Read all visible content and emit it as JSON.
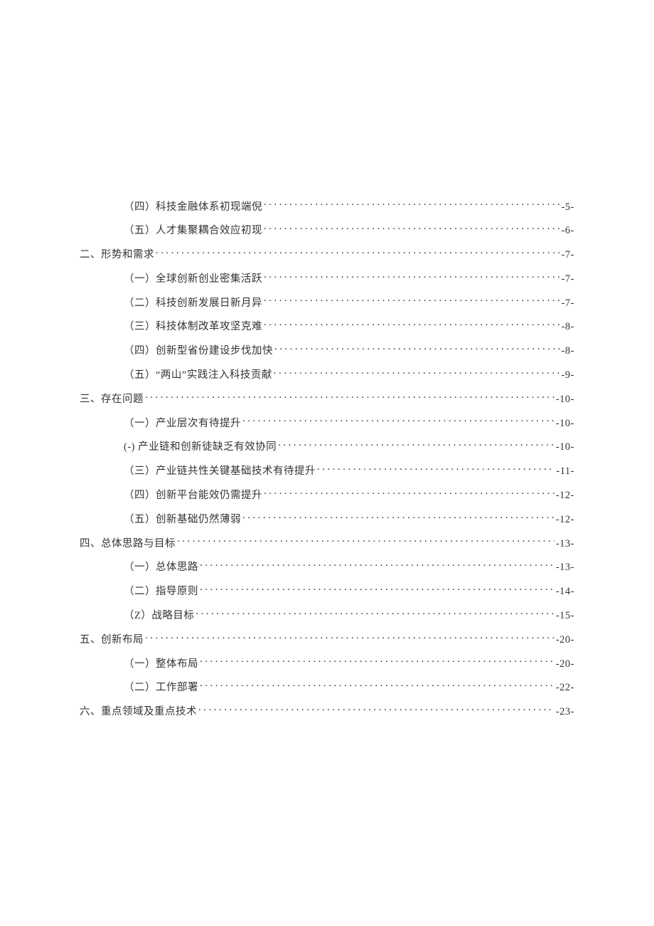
{
  "toc": [
    {
      "level": 2,
      "label": "（四）科技金融体系初现端倪",
      "page": "-5-"
    },
    {
      "level": 2,
      "label": "（五）人才集聚耦合效应初现",
      "page": "-6-"
    },
    {
      "level": 1,
      "label": "二、形势和需求",
      "page": "-7-"
    },
    {
      "level": 2,
      "label": "（一）全球创新创业密集活跃",
      "page": "-7-"
    },
    {
      "level": 2,
      "label": "（二）科技创新发展日新月异",
      "page": "-7-"
    },
    {
      "level": 2,
      "label": "（三）科技体制改革攻坚克难",
      "page": "-8-"
    },
    {
      "level": 2,
      "label": "（四）创新型省份建设步伐加快",
      "page": "-8-"
    },
    {
      "level": 2,
      "label": "（五）“两山”实践注入科技贡献",
      "page": "-9-"
    },
    {
      "level": 1,
      "label": "三、存在问题",
      "page": "-10-"
    },
    {
      "level": 2,
      "label": "（一）产业层次有待提升",
      "page": "-10-"
    },
    {
      "level": 2,
      "label": "(-) 产业链和创新徒缺乏有效协同",
      "page": "-10-"
    },
    {
      "level": 2,
      "label": "（三）产业链共性关键基础技术有待提升",
      "page": "-11-"
    },
    {
      "level": 2,
      "label": "（四）创新平台能效仍需提升",
      "page": "-12-"
    },
    {
      "level": 2,
      "label": "（五）创新基础仍然薄弱",
      "page": "-12-"
    },
    {
      "level": 1,
      "label": "四、总体思路与目标",
      "page": "-13-"
    },
    {
      "level": 2,
      "label": "（一）总体思路",
      "page": "-13-"
    },
    {
      "level": 2,
      "label": "（二）指导原则",
      "page": "-14-"
    },
    {
      "level": 2,
      "label": "（Z）战略目标",
      "page": "-15-"
    },
    {
      "level": 1,
      "label": "五、创新布局",
      "page": "-20-"
    },
    {
      "level": 2,
      "label": "（一）整体布局",
      "page": "-20-"
    },
    {
      "level": 2,
      "label": "（二）工作部署",
      "page": "-22-"
    },
    {
      "level": 1,
      "label": "六、重点领域及重点技术",
      "page": "-23-"
    }
  ]
}
